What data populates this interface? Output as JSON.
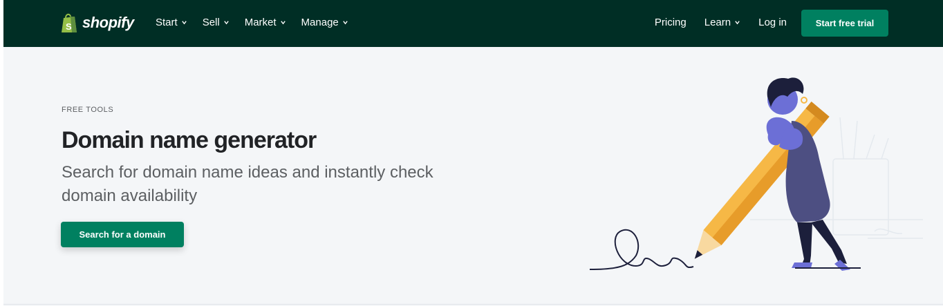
{
  "brand": {
    "name": "shopify",
    "logo_icon": "shopping-bag-icon",
    "colors": {
      "nav_bg": "#002e25",
      "accent": "#008060",
      "page_bg": "#f4f6f8"
    }
  },
  "nav": {
    "left": [
      {
        "label": "Start",
        "icon": "chevron-down-icon"
      },
      {
        "label": "Sell",
        "icon": "chevron-down-icon"
      },
      {
        "label": "Market",
        "icon": "chevron-down-icon"
      },
      {
        "label": "Manage",
        "icon": "chevron-down-icon"
      }
    ],
    "right": [
      {
        "label": "Pricing"
      },
      {
        "label": "Learn",
        "icon": "chevron-down-icon"
      },
      {
        "label": "Log in"
      }
    ],
    "cta": "Start free trial"
  },
  "hero": {
    "eyebrow": "FREE TOOLS",
    "title": "Domain name generator",
    "subtitle": "Search for domain name ideas and instantly check domain availability",
    "cta": "Search for a domain",
    "illustration": "person-with-giant-pencil-illustration"
  }
}
